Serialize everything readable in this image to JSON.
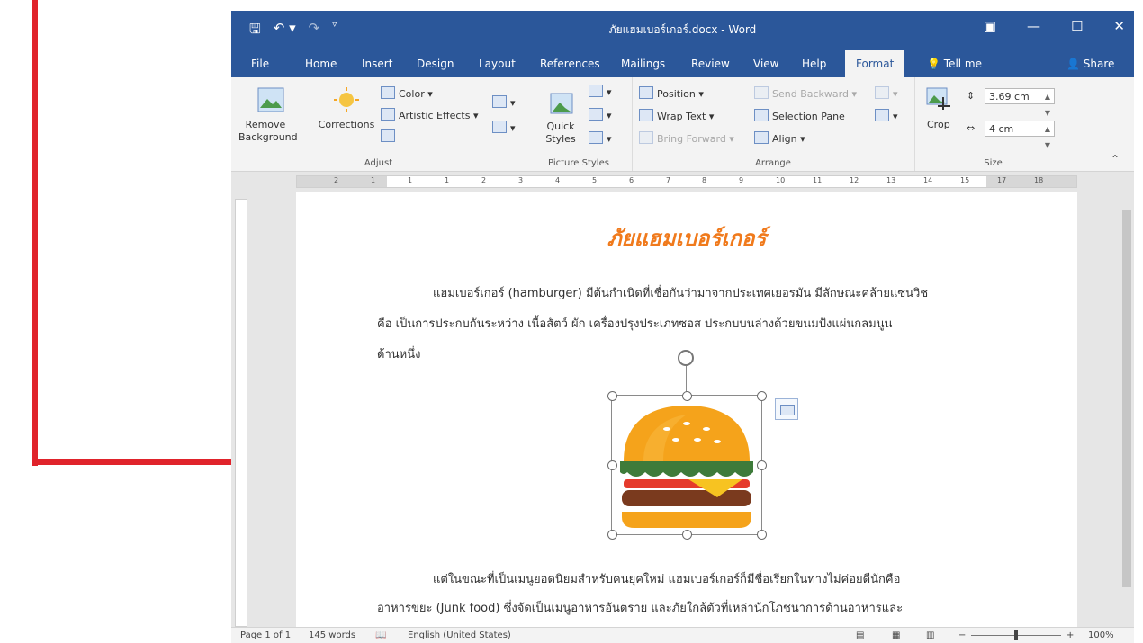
{
  "colors": {
    "accent": "#2b579a",
    "callout": "#e0232b",
    "title_orange": "#f07a1c"
  },
  "titlebar": {
    "title": "ภัยแฮมเบอร์เกอร์.docx - Word",
    "qat_icons": [
      "save-icon",
      "undo-icon",
      "redo-icon",
      "customize-icon"
    ],
    "window_icons": [
      "ribbon-display-icon",
      "minimize-icon",
      "maximize-icon",
      "close-icon"
    ]
  },
  "tabs": [
    "File",
    "Home",
    "Insert",
    "Design",
    "Layout",
    "References",
    "Mailings",
    "Review",
    "View",
    "Help",
    "Format"
  ],
  "tab_active": "Format",
  "tell_me": "Tell me",
  "share": "Share",
  "ribbon": {
    "adjust": {
      "label": "Adjust",
      "remove_background": "Remove Background",
      "corrections": "Corrections",
      "color": "Color",
      "artistic_effects": "Artistic Effects"
    },
    "picture_styles": {
      "label": "Picture Styles",
      "quick_styles": "Quick Styles"
    },
    "arrange": {
      "label": "Arrange",
      "position": "Position",
      "wrap_text": "Wrap Text",
      "bring_forward": "Bring Forward",
      "send_backward": "Send Backward",
      "selection_pane": "Selection Pane",
      "align": "Align"
    },
    "size": {
      "label": "Size",
      "crop": "Crop",
      "height": "3.69 cm",
      "width": "4 cm"
    }
  },
  "ruler": {
    "marks": [
      "2",
      "1",
      "1",
      "1",
      "2",
      "3",
      "4",
      "5",
      "6",
      "7",
      "8",
      "9",
      "10",
      "11",
      "12",
      "13",
      "14",
      "15",
      "17",
      "18"
    ],
    "corner": "L"
  },
  "document": {
    "title": "ภัยแฮมเบอร์เกอร์",
    "para1_line1": "แฮมเบอร์เกอร์ (hamburger) มีต้นกำเนิดที่เชื่อกันว่ามาจากประเทศเยอรมัน มีลักษณะคล้ายแซนวิช",
    "para1_line2": "คือ เป็นการประกบกันระหว่าง เนื้อสัตว์ ผัก เครื่องปรุงประเภทซอส ประกบบนล่างด้วยขนมปังแผ่นกลมนูน",
    "para1_line3": "ด้านหนึ่ง",
    "para2_line1": "แต่ในขณะที่เป็นเมนูยอดนิยมสำหรับคนยุคใหม่  แฮมเบอร์เกอร์ก็มีชื่อเรียกในทางไม่ค่อยดีนักคือ",
    "para2_line2": "อาหารขยะ (Junk food) ซึ่งจัดเป็นเมนูอาหารอันตราย และภัยใกล้ตัวที่เหล่านักโภชนาการด้านอาหารและ"
  },
  "statusbar": {
    "page": "Page 1 of 1",
    "words": "145 words",
    "language": "English (United States)",
    "zoom": "100%",
    "minus": "−",
    "plus": "+"
  }
}
